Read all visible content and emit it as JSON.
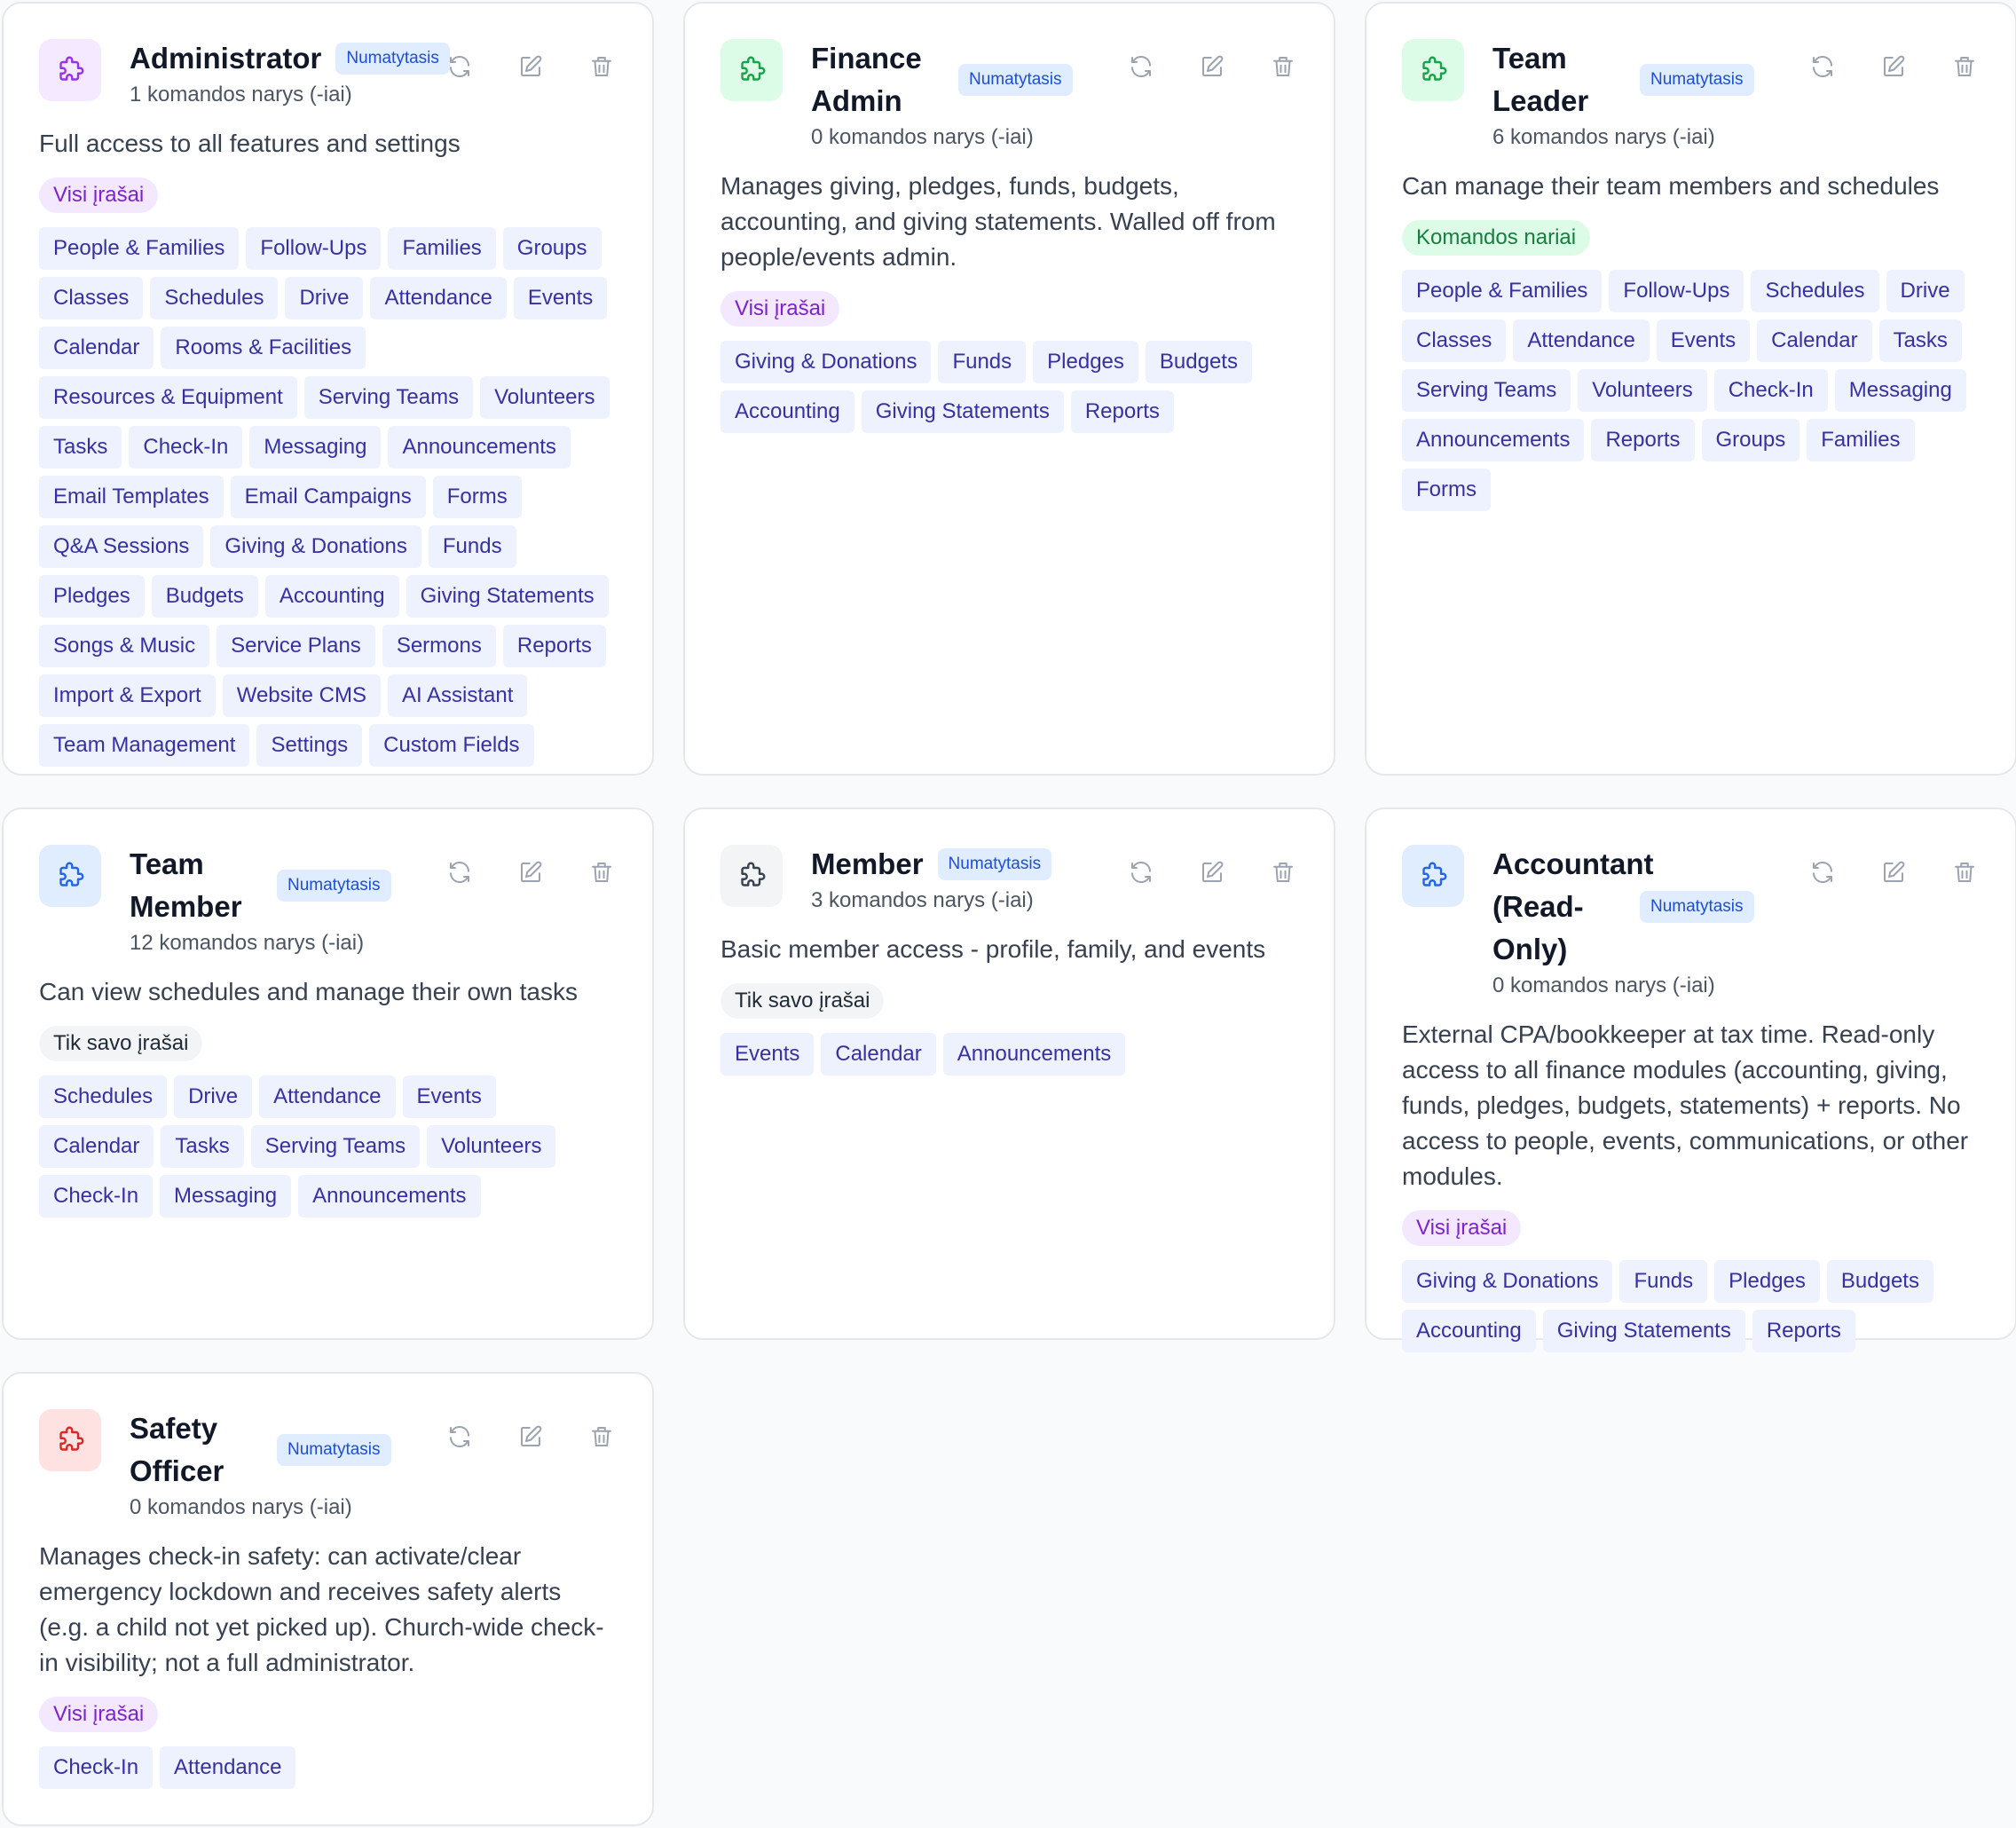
{
  "default_badge": "Numatytasis",
  "icons": {
    "role": "puzzle-icon",
    "refresh": "refresh-icon",
    "edit": "edit-icon",
    "delete": "trash-icon"
  },
  "colors": {
    "purple_bg": "#f5e9ff",
    "purple_fg": "#9333ea",
    "green_bg": "#dcfce7",
    "green_fg": "#16a34a",
    "blue_bg": "#e0ecff",
    "blue_fg": "#2563eb",
    "gray_bg": "#f3f4f6",
    "gray_fg": "#374151",
    "red_bg": "#fee2e2",
    "red_fg": "#dc2626"
  },
  "roles": [
    {
      "title": "Administrator",
      "members": "1 komandos narys (-iai)",
      "description": "Full access to all features and settings",
      "scope": "Visi įrašai",
      "permissions": [
        "People & Families",
        "Follow-Ups",
        "Families",
        "Groups",
        "Classes",
        "Schedules",
        "Drive",
        "Attendance",
        "Events",
        "Calendar",
        "Rooms & Facilities",
        "Resources & Equipment",
        "Serving Teams",
        "Volunteers",
        "Tasks",
        "Check-In",
        "Messaging",
        "Announcements",
        "Email Templates",
        "Email Campaigns",
        "Forms",
        "Q&A Sessions",
        "Giving & Donations",
        "Funds",
        "Pledges",
        "Budgets",
        "Accounting",
        "Giving Statements",
        "Songs & Music",
        "Service Plans",
        "Sermons",
        "Reports",
        "Import & Export",
        "Website CMS",
        "AI Assistant",
        "Team Management",
        "Settings",
        "Custom Fields"
      ]
    },
    {
      "title": "Finance Admin",
      "members": "0 komandos narys (-iai)",
      "description": "Manages giving, pledges, funds, budgets, accounting, and giving statements. Walled off from people/events admin.",
      "scope": "Visi įrašai",
      "permissions": [
        "Giving & Donations",
        "Funds",
        "Pledges",
        "Budgets",
        "Accounting",
        "Giving Statements",
        "Reports"
      ]
    },
    {
      "title": "Team Leader",
      "members": "6 komandos narys (-iai)",
      "description": "Can manage their team members and schedules",
      "scope": "Komandos nariai",
      "permissions": [
        "People & Families",
        "Follow-Ups",
        "Schedules",
        "Drive",
        "Classes",
        "Attendance",
        "Events",
        "Calendar",
        "Tasks",
        "Serving Teams",
        "Volunteers",
        "Check-In",
        "Messaging",
        "Announcements",
        "Reports",
        "Groups",
        "Families",
        "Forms"
      ]
    },
    {
      "title": "Team Member",
      "members": "12 komandos narys (-iai)",
      "description": "Can view schedules and manage their own tasks",
      "scope": "Tik savo įrašai",
      "permissions": [
        "Schedules",
        "Drive",
        "Attendance",
        "Events",
        "Calendar",
        "Tasks",
        "Serving Teams",
        "Volunteers",
        "Check-In",
        "Messaging",
        "Announcements"
      ]
    },
    {
      "title": "Member",
      "members": "3 komandos narys (-iai)",
      "description": "Basic member access - profile, family, and events",
      "scope": "Tik savo įrašai",
      "permissions": [
        "Events",
        "Calendar",
        "Announcements"
      ]
    },
    {
      "title": "Accountant (Read-Only)",
      "members": "0 komandos narys (-iai)",
      "description": "External CPA/bookkeeper at tax time. Read-only access to all finance modules (accounting, giving, funds, pledges, budgets, statements) + reports. No access to people, events, communications, or other modules.",
      "scope": "Visi įrašai",
      "permissions": [
        "Giving & Donations",
        "Funds",
        "Pledges",
        "Budgets",
        "Accounting",
        "Giving Statements",
        "Reports"
      ]
    },
    {
      "title": "Safety Officer",
      "members": "0 komandos narys (-iai)",
      "description": "Manages check-in safety: can activate/clear emergency lockdown and receives safety alerts (e.g. a child not yet picked up). Church-wide check-in visibility; not a full administrator.",
      "scope": "Visi įrašai",
      "permissions": [
        "Check-In",
        "Attendance"
      ]
    }
  ]
}
